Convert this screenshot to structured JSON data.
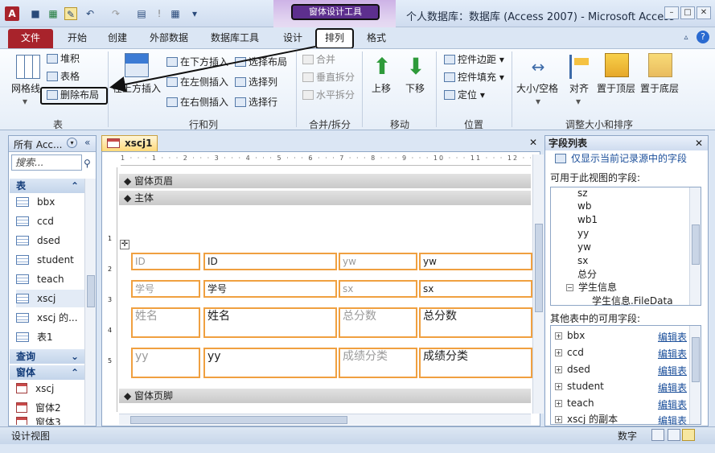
{
  "window": {
    "title": "个人数据库：数据库 (Access 2007) - Microsoft Access",
    "context_tools": "窗体设计工具",
    "app_icon": "A",
    "controls": [
      "minimize-icon",
      "maximize-icon",
      "close-icon"
    ]
  },
  "tabs": [
    {
      "label": "文件"
    },
    {
      "label": "开始"
    },
    {
      "label": "创建"
    },
    {
      "label": "外部数据"
    },
    {
      "label": "数据库工具"
    },
    {
      "label": "设计"
    },
    {
      "label": "排列"
    },
    {
      "label": "格式"
    }
  ],
  "ribbon": {
    "table_group": {
      "label": "表",
      "gridlines": "网格线",
      "stacked": "堆积",
      "tabular": "表格",
      "remove_layout": "删除布局"
    },
    "rows_cols_group": {
      "label": "行和列",
      "insert_above": "在上方插入",
      "insert_below": "在下方插入",
      "insert_left": "在左侧插入",
      "insert_right": "在右侧插入",
      "select_layout": "选择布局",
      "select_column": "选择列",
      "select_row": "选择行"
    },
    "merge_group": {
      "label": "合并/拆分",
      "merge": "合并",
      "split_v": "垂直拆分",
      "split_h": "水平拆分"
    },
    "move_group": {
      "label": "移动",
      "up": "上移",
      "down": "下移"
    },
    "position_group": {
      "label": "位置",
      "margins": "控件边距",
      "padding": "控件填充",
      "anchor": "定位"
    },
    "size_group": {
      "label": "调整大小和排序",
      "size_space": "大小/空格",
      "align": "对齐",
      "to_front": "置于顶层",
      "to_back": "置于底层"
    }
  },
  "nav": {
    "header": "所有 Acc...",
    "search_placeholder": "搜索...",
    "tables_label": "表",
    "tables": [
      "bbx",
      "ccd",
      "dsed",
      "student",
      "teach",
      "xscj",
      "xscj 的...",
      "表1"
    ],
    "queries_label": "查询",
    "forms_label": "窗体",
    "forms": [
      "xscj",
      "窗体2",
      "窗体3"
    ]
  },
  "document": {
    "tab": "xscj1",
    "ruler": "1 · · · 1 · · · 2 · · · 3 · · · 4 · · · 5 · · · 6 · · · 7 · · · 8 · · · 9 · · · 10 · · · 11 · · · 12 · · · 13 · · · 14 · · · 15 · · · 16 · · · 17",
    "vruler": [
      "1",
      "2",
      "3",
      "4",
      "5"
    ],
    "sections": {
      "header": "窗体页眉",
      "detail": "主体",
      "footer": "窗体页脚"
    },
    "rows": [
      [
        "ID",
        "ID",
        "yw",
        "yw"
      ],
      [
        "学号",
        "学号",
        "sx",
        "sx"
      ],
      [
        "姓名",
        "姓名",
        "总分数",
        "总分数"
      ],
      [
        "yy",
        "yy",
        "成绩分类",
        "成绩分类"
      ]
    ]
  },
  "field_list": {
    "title": "字段列表",
    "show_current_link": "仅显示当前记录源中的字段",
    "available_label": "可用于此视图的字段:",
    "fields": [
      "sz",
      "wb",
      "wb1",
      "yy",
      "yw",
      "sx",
      "总分"
    ],
    "group": "学生信息",
    "group_child": "学生信息.FileData",
    "other_label": "其他表中的可用字段:",
    "other_tables": [
      "bbx",
      "ccd",
      "dsed",
      "student",
      "teach",
      "xscj 的副本"
    ],
    "edit_label": "编辑表"
  },
  "status": {
    "left": "设计视图",
    "right": "数字"
  }
}
